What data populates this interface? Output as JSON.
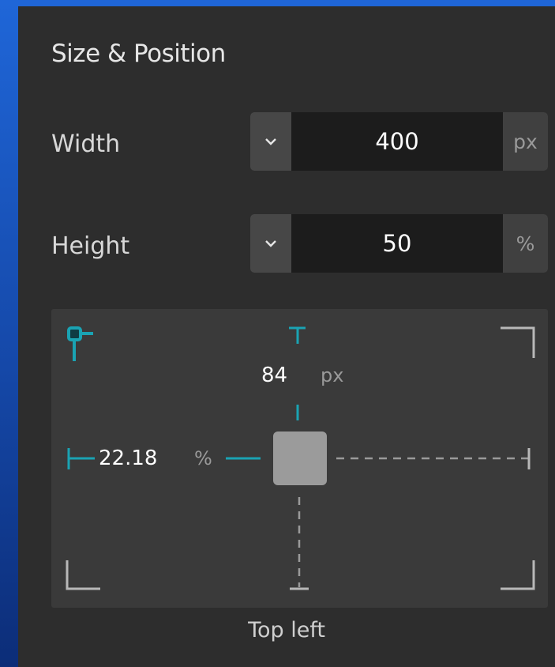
{
  "panel": {
    "title": "Size & Position"
  },
  "width": {
    "label": "Width",
    "value": "400",
    "unit": "px"
  },
  "height": {
    "label": "Height",
    "value": "50",
    "unit": "%"
  },
  "position": {
    "top_offset": "84",
    "top_unit": "px",
    "left_offset": "22.18",
    "left_unit": "%",
    "anchor": "Top left"
  },
  "colors": {
    "accent": "#1aa3b3",
    "panel_bg": "#2d2d2d",
    "input_bg": "#1c1c1c",
    "dropdown_bg": "#474747",
    "unit_bg": "#404040",
    "position_box_bg": "#3a3a3a",
    "dashed_guide": "#9a9a9a"
  },
  "icons": {
    "dropdown": "chevron-down-icon",
    "anchor_marker": "anchor-pin-icon",
    "corner": "corner-bracket-icon"
  }
}
